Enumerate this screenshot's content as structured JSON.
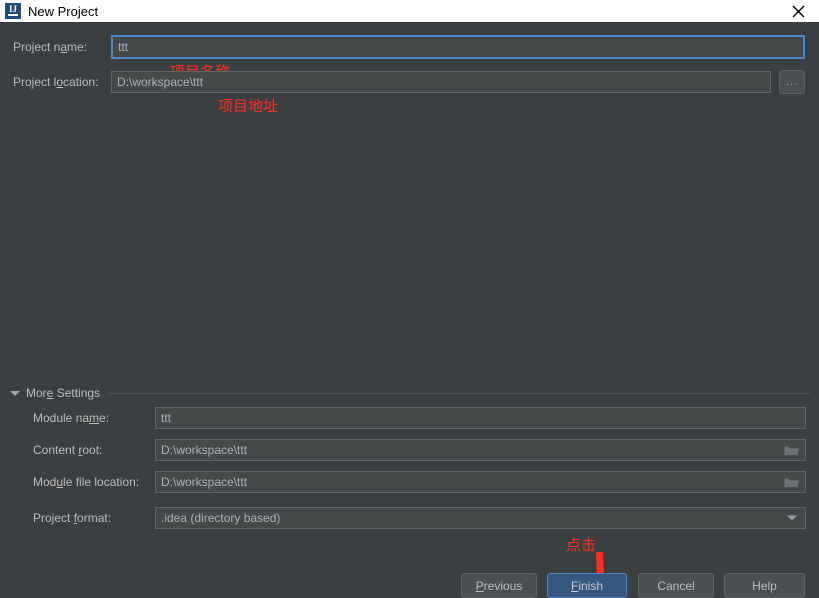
{
  "window": {
    "title": "New Project",
    "app_icon": "intellij-idea-icon",
    "close_icon": "close-icon"
  },
  "form": {
    "project_name": {
      "label_prefix": "Project n",
      "label_mnemonic": "a",
      "label_suffix": "me:",
      "value": "ttt",
      "annotation": "项目名称"
    },
    "project_location": {
      "label_prefix": "Project l",
      "label_mnemonic": "o",
      "label_suffix": "cation:",
      "value": "D:\\workspace\\ttt",
      "annotation": "项目地址",
      "browse_label": "..."
    }
  },
  "more_settings": {
    "label_prefix": "Mor",
    "label_mnemonic": "e",
    "label_suffix": " Settings",
    "expanded": true,
    "triangle_icon": "triangle-down-icon",
    "fields": {
      "module_name": {
        "label_prefix": "Module na",
        "label_mnemonic": "m",
        "label_suffix": "e:",
        "value": "ttt"
      },
      "content_root": {
        "label_prefix": "Content ",
        "label_mnemonic": "r",
        "label_suffix": "oot:",
        "value": "D:\\workspace\\ttt",
        "browse_icon": "folder-icon"
      },
      "module_file_location": {
        "label_prefix": "Mod",
        "label_mnemonic": "u",
        "label_suffix": "le file location:",
        "value": "D:\\workspace\\ttt",
        "browse_icon": "folder-icon"
      },
      "project_format": {
        "label_prefix": "Project ",
        "label_mnemonic": "f",
        "label_suffix": "ormat:",
        "value": ".idea (directory based)",
        "annotation": "点击",
        "dropdown_icon": "chevron-down-icon"
      }
    }
  },
  "buttons": {
    "previous": {
      "prefix": "",
      "mnemonic": "P",
      "suffix": "revious"
    },
    "finish": {
      "prefix": "",
      "mnemonic": "F",
      "suffix": "inish"
    },
    "cancel": {
      "prefix": "Cancel",
      "mnemonic": "",
      "suffix": ""
    },
    "help": {
      "prefix": "Help",
      "mnemonic": "",
      "suffix": ""
    }
  },
  "colors": {
    "background": "#3c3f41",
    "titlebar": "#ffffff",
    "field_bg": "#45494a",
    "field_border": "#646464",
    "focus_border": "#4a88c7",
    "default_button": "#365880",
    "annotation_red": "#ff2d1e",
    "text": "#bbbbbb"
  }
}
